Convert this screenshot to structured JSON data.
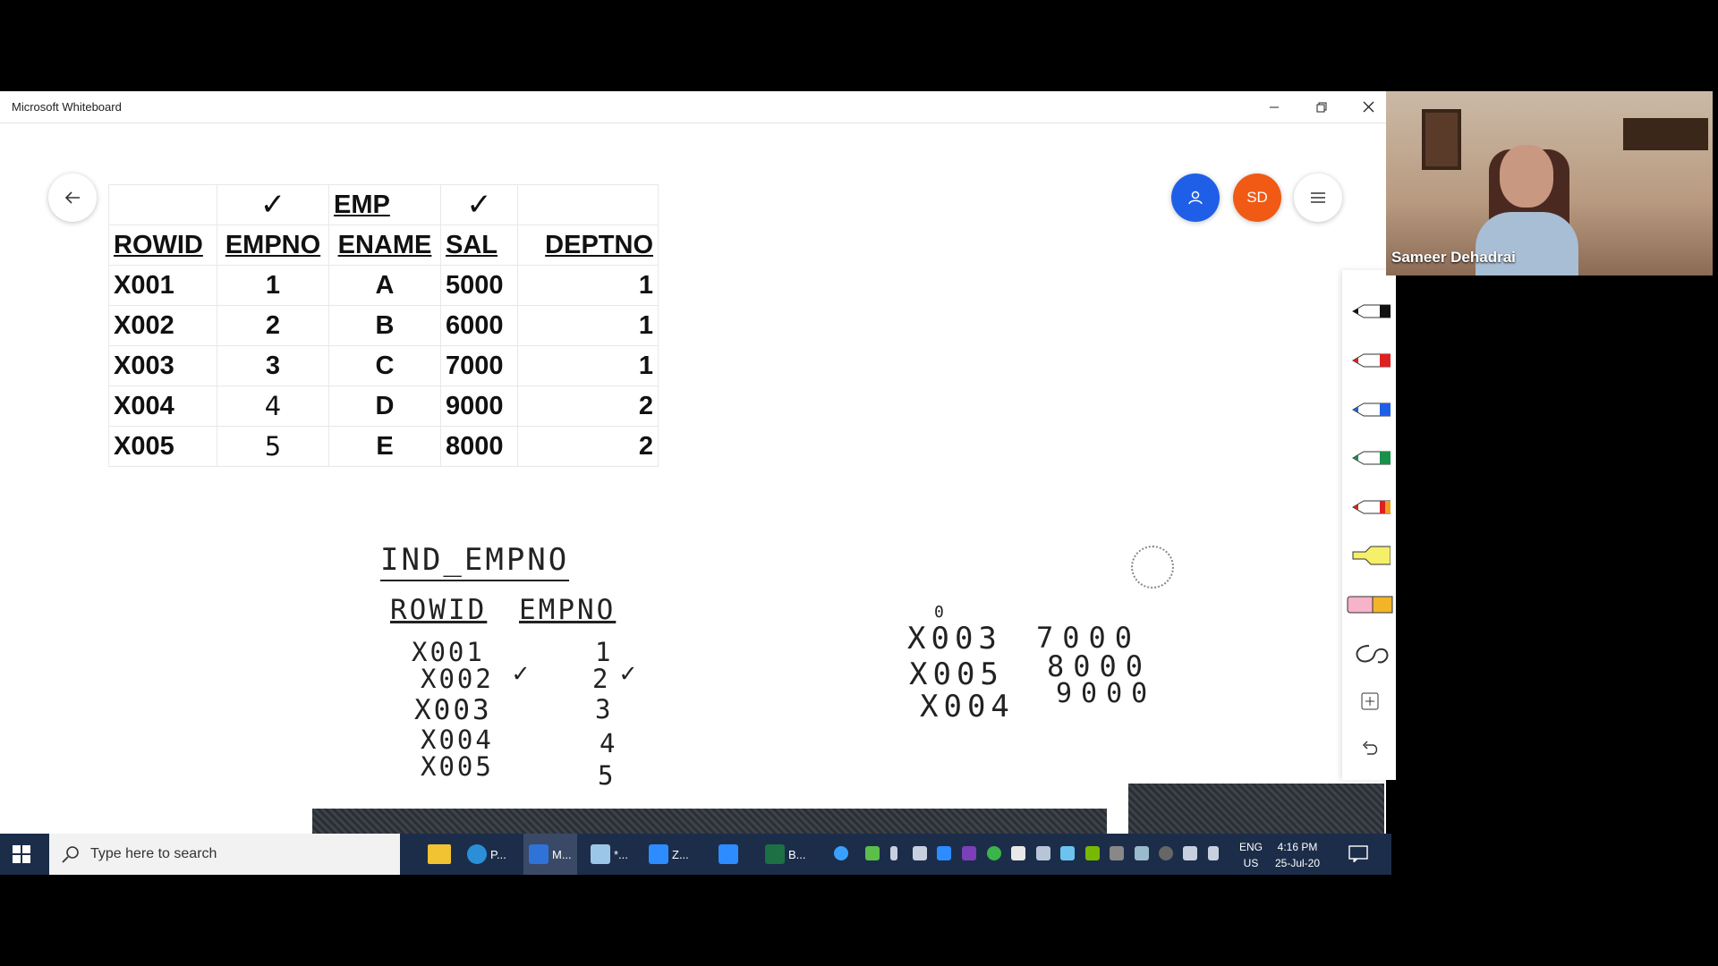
{
  "window": {
    "title": "Microsoft Whiteboard"
  },
  "participants": {
    "avatar_initials": "SD"
  },
  "table": {
    "title": "EMP",
    "headers": [
      "ROWID",
      "EMPNO",
      "ENAME",
      "SAL",
      "DEPTNO"
    ],
    "rows": [
      [
        "X001",
        "1",
        "A",
        "5000",
        "1"
      ],
      [
        "X002",
        "2",
        "B",
        "6000",
        "1"
      ],
      [
        "X003",
        "3",
        "C",
        "7000",
        "1"
      ],
      [
        "X004",
        "4",
        "D",
        "9000",
        "2"
      ],
      [
        "X005",
        "5",
        "E",
        "8000",
        "2"
      ]
    ]
  },
  "handwriting": {
    "index_title": "IND_EMPNO",
    "index_headers": [
      "ROWID",
      "EMPNO"
    ],
    "index_rows": [
      [
        "X001",
        "1"
      ],
      [
        "X002",
        "2"
      ],
      [
        "X003",
        "3"
      ],
      [
        "X004",
        "4"
      ],
      [
        "X005",
        "5"
      ]
    ],
    "sorted_rows": [
      [
        "X003",
        "7000"
      ],
      [
        "X005",
        "8000"
      ],
      [
        "X004",
        "9000"
      ]
    ],
    "small_mark": "0"
  },
  "video": {
    "speaker_name": "Sameer Dehadrai"
  },
  "taskbar": {
    "search_placeholder": "Type here to search",
    "apps": [
      {
        "label": "P...",
        "icon": "edge-icon"
      },
      {
        "label": "M...",
        "icon": "whiteboard-icon"
      },
      {
        "label": "*...",
        "icon": "notepad-icon"
      },
      {
        "label": "Z...",
        "icon": "zoom-icon"
      },
      {
        "label": "",
        "icon": "zoom-icon"
      },
      {
        "label": "B...",
        "icon": "excel-icon"
      }
    ],
    "lang": "ENG",
    "region": "US",
    "time": "4:16 PM",
    "date": "25-Jul-20"
  },
  "colors": {
    "avatar_blue": "#1f5fe8",
    "avatar_orange": "#f05a14",
    "taskbar": "#1c2d4a"
  }
}
